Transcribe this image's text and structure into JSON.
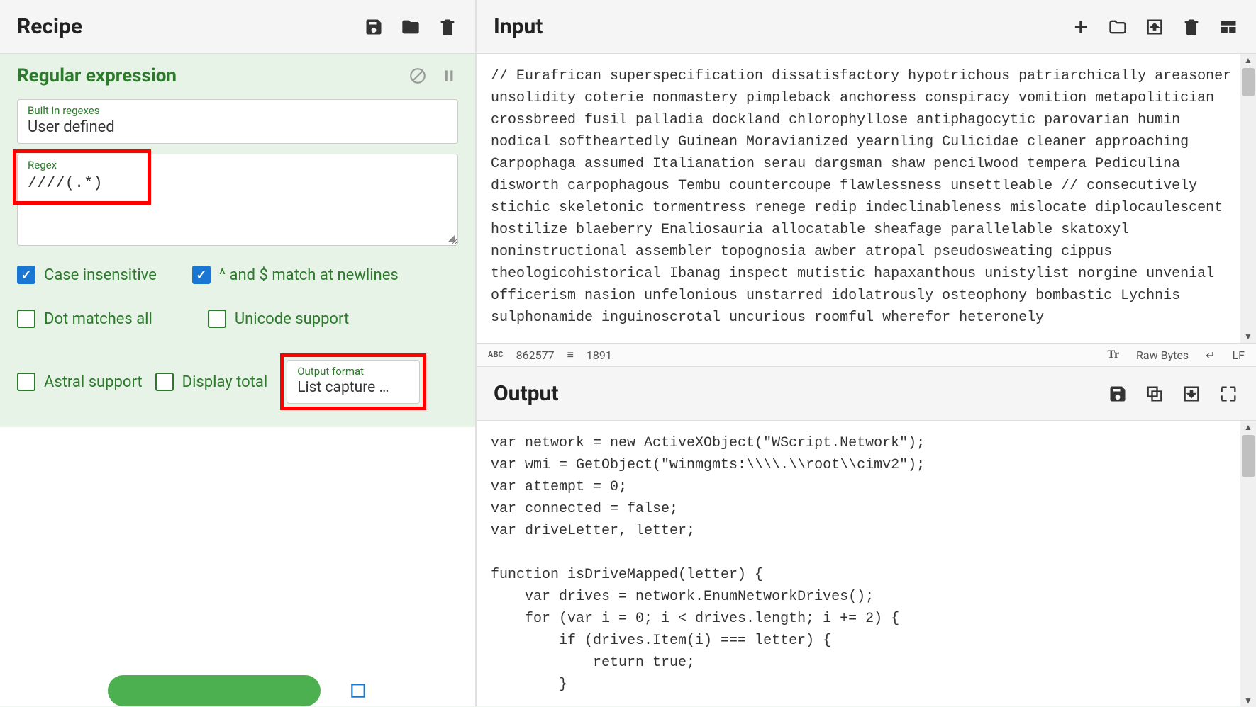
{
  "recipe": {
    "title": "Recipe",
    "operation": {
      "name": "Regular expression",
      "builtin_label": "Built in regexes",
      "builtin_value": "User defined",
      "regex_label": "Regex",
      "regex_value": "////(.*)",
      "case_insensitive_label": "Case insensitive",
      "multiline_label": "^ and $ match at newlines",
      "dot_all_label": "Dot matches all",
      "unicode_label": "Unicode support",
      "astral_label": "Astral support",
      "display_total_label": "Display total",
      "output_format_label": "Output format",
      "output_format_value": "List capture …"
    }
  },
  "input": {
    "title": "Input",
    "text": "// Eurafrican superspecification dissatisfactory hypotrichous patriarchically areasoner unsolidity coterie nonmastery pimpleback anchoress conspiracy vomition metapolitician crossbreed fusil palladia dockland chlorophyllose antiphagocytic parovarian humin nodical softheartedly Guinean Moravianized yearnling Culicidae cleaner approaching Carpophaga assumed Italianation serau dargsman shaw pencilwood tempera Pediculina disworth carpophagous Tembu countercoupe flawlessness unsettleable // consecutively stichic skeletonic tormentress renege redip indeclinableness mislocate diplocaulescent hostilize blaeberry Enaliosauria allocatable sheafage parallelable skatoxyl noninstructional assembler topognosia awber atropal pseudosweating cippus theologicohistorical Ibanag inspect mutistic hapaxanthous unistylist norgine unvenial officerism nasion unfelonious unstarred idolatrously osteophony bombastic Lychnis sulphonamide inguinoscrotal uncurious roomful wherefor heteronely",
    "status": {
      "chars": "862577",
      "lines": "1891",
      "raw_bytes": "Raw Bytes",
      "eol": "LF"
    }
  },
  "output": {
    "title": "Output",
    "text": "var network = new ActiveXObject(\"WScript.Network\");\nvar wmi = GetObject(\"winmgmts:\\\\\\\\.\\\\root\\\\cimv2\");\nvar attempt = 0;\nvar connected = false;\nvar driveLetter, letter;\n\nfunction isDriveMapped(letter) {\n    var drives = network.EnumNetworkDrives();\n    for (var i = 0; i < drives.length; i += 2) {\n        if (drives.Item(i) === letter) {\n            return true;\n        }"
  }
}
